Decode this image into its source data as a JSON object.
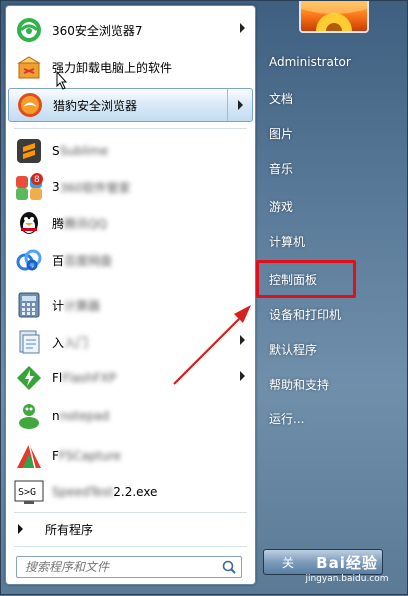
{
  "pinned_programs": [
    {
      "label": "360安全浏览器7",
      "icon": "360-browser-icon",
      "has_submenu": true,
      "highlighted": false
    },
    {
      "label": "强力卸载电脑上的软件",
      "icon": "uninstall-box-icon",
      "has_submenu": false,
      "highlighted": false
    },
    {
      "label": "猎豹安全浏览器",
      "icon": "liebao-browser-icon",
      "has_submenu": true,
      "highlighted": true
    }
  ],
  "recent_programs": [
    {
      "label": "S",
      "blurred_label": "Sublime",
      "icon": "sublime-icon",
      "has_submenu": false
    },
    {
      "label": "3",
      "blurred_label": "360软件管家",
      "icon": "apps-icon",
      "has_submenu": false
    },
    {
      "label": "腾",
      "blurred_label": "腾讯QQ",
      "icon": "qq-penguin-icon",
      "has_submenu": false
    },
    {
      "label": "百",
      "blurred_label": "百度网盘",
      "icon": "baidu-cloud-icon",
      "has_submenu": false
    },
    {
      "label": "计",
      "blurred_label": "计算器",
      "icon": "calculator-icon",
      "has_submenu": false
    },
    {
      "label": "入",
      "blurred_label": "入门",
      "icon": "getting-started-icon",
      "has_submenu": true
    },
    {
      "label": "Fl",
      "blurred_label": "FlashFXP",
      "icon": "flashfxp-icon",
      "has_submenu": true
    },
    {
      "label": "n",
      "blurred_label": "notepad",
      "icon": "green-figure-icon",
      "has_submenu": false
    },
    {
      "label": "F",
      "blurred_label": "FSCapture",
      "icon": "fscapture-icon",
      "has_submenu": false
    },
    {
      "label": "2.2.exe",
      "blurred_label": "SpeedTest",
      "icon": "sg-exe-icon",
      "has_submenu": false
    }
  ],
  "all_programs_label": "所有程序",
  "search": {
    "placeholder": "搜索程序和文件"
  },
  "right_pane": {
    "user": "Administrator",
    "items": [
      "文档",
      "图片",
      "音乐",
      "游戏",
      "计算机",
      "控制面板",
      "设备和打印机",
      "默认程序",
      "帮助和支持",
      "运行..."
    ]
  },
  "shutdown_label": "关",
  "watermark": {
    "main": "Bai经验",
    "sub": "jingyan.baidu.com"
  },
  "colors": {
    "highlight_red": "#e0101a",
    "arrow_red": "#d81e1e"
  }
}
